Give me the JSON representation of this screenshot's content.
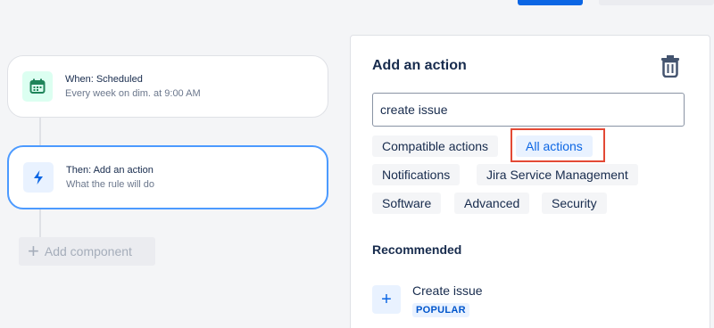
{
  "rule": {
    "trigger": {
      "title": "When: Scheduled",
      "subtitle": "Every week on dim. at 9:00 AM",
      "icon": "calendar-icon"
    },
    "action": {
      "title": "Then: Add an action",
      "subtitle": "What the rule will do",
      "icon": "lightning-icon"
    },
    "add_component_label": "Add component"
  },
  "panel": {
    "title": "Add an action",
    "search": {
      "value": "create issue"
    },
    "filters": [
      "Compatible actions",
      "All actions",
      "Notifications",
      "Jira Service Management",
      "Software",
      "Advanced",
      "Security"
    ],
    "active_filter": "All actions",
    "recommended_title": "Recommended",
    "recommended": [
      {
        "label": "Create issue",
        "badge": "POPULAR"
      }
    ]
  },
  "colors": {
    "accent": "#0c66e4",
    "highlight": "#e34935",
    "calendar_green": "#1f845a"
  }
}
